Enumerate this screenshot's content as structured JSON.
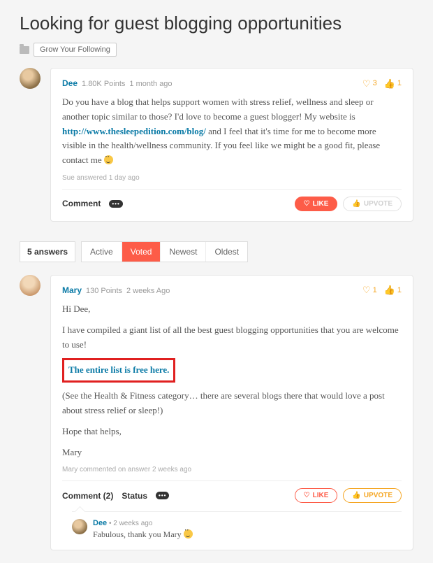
{
  "title": "Looking for guest blogging opportunities",
  "category": "Grow Your Following",
  "post": {
    "author": "Dee",
    "points": "1.80K Points",
    "time": "1 month ago",
    "hearts": "3",
    "thumbs": "1",
    "body_prefix": "Do you have a blog that helps support women with stress relief, wellness and sleep or another topic similar to those? I'd love to become a guest blogger! My website is ",
    "link": "http://www.thesleepedition.com/blog/",
    "body_suffix": " and I feel that it's time for me to become more visible in the health/wellness community. If you feel like we might be a good fit, please contact me ",
    "meta": "Sue answered 1 day ago",
    "comment_label": "Comment",
    "like_label": "LIKE",
    "upvote_label": "UPVOTE"
  },
  "answers": {
    "count_label": "5 answers",
    "tabs": [
      "Active",
      "Voted",
      "Newest",
      "Oldest"
    ],
    "active_tab": "Voted"
  },
  "answer": {
    "author": "Mary",
    "points": "130 Points",
    "time": "2 weeks Ago",
    "hearts": "1",
    "thumbs": "1",
    "p1": "Hi Dee,",
    "p2": "I have compiled a giant list of all the best guest blogging opportunities that you are welcome to use!",
    "highlight_link": "The entire list is free here.",
    "p3": "(See the Health & Fitness category… there are several blogs there that would love a post about stress relief or sleep!)",
    "p4": "Hope that helps,",
    "p5": "Mary",
    "meta": "Mary commented on answer 2 weeks ago",
    "comment_label": "Comment (2)",
    "status_label": "Status",
    "like_label": "LIKE",
    "upvote_label": "UPVOTE",
    "reply": {
      "author": "Dee",
      "time": "2 weeks ago",
      "text": "Fabulous, thank you Mary "
    }
  }
}
